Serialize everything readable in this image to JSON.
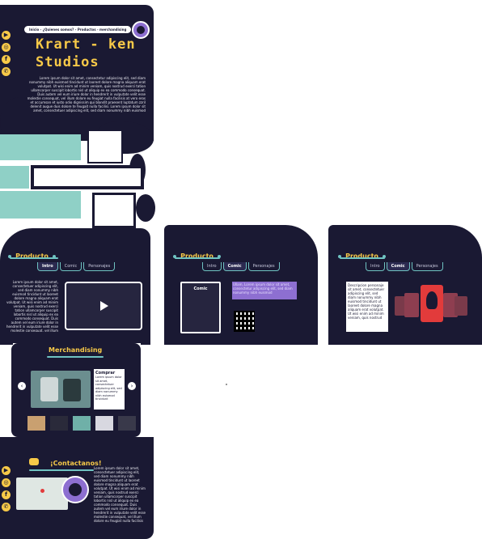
{
  "colors": {
    "navy": "#1a1933",
    "yellow": "#f7c948",
    "teal": "#6fc3c2",
    "purple": "#8d6fd1",
    "red": "#e23b3b"
  },
  "social_icons": [
    "youtube-icon",
    "instagram-icon",
    "facebook-icon",
    "whatsapp-icon"
  ],
  "hero": {
    "breadcrumb": "Inicio - ¿Quienes somos? - Productos - merchandising",
    "title_line1": "Krart - ken",
    "title_line2": "Studios",
    "paragraph": "Lorem ipsum dolor sit amet, consectetur adipiscing elit, sed diam nonummy nibh euismod tincidunt ut laoreet dolore magna aliquam erat volutpat. Ut wisi enim ad minim veniam, quis nostrud exerci tation ullamcorper suscipit lobortis nisl ut aliquip ex ea commodo consequat. Duis autem vel eum iriure dolor in hendrerit in vulputate velit esse molestie consequat, vel illum dolore eu feugiat nulla facilisis at vero eros et accumsan et iusto odio dignissim qui blandit praesent luptatum zzril delenit augue duis dolore te feugait nulla facilisi. Lorem ipsum dolor sit amet, consectetuer adipiscing elit, sed diam nonummy nibh euismod"
  },
  "products": [
    {
      "title": "Producto",
      "tabs": [
        "Intro",
        "Comic",
        "Personajes"
      ],
      "active": "Intro",
      "text": "Lorem ipsum dolor sit amet, consectetuer adipiscing elit, sed diam nonummy nibh euismod tincidunt ut laoreet dolore magna aliquam erat volutpat. Ut wisi enim ad minim veniam, quis nostrud exerci tation ullamcorper suscipit lobortis nisl ut aliquip ex ea commodo consequat. Duis autem vel eum iriure dolor in hendrerit in vulputate velit esse molestie consequat, vel illum dolore eu feugiat nulla"
    },
    {
      "title": "Producto",
      "tabs": [
        "Intro",
        "Comic",
        "Personajes"
      ],
      "active": "Comic",
      "cover_label": "Comic",
      "text": "Ullam, Lorem ipsum dolor sit amet, consectetur adipiscing elit, sed diam nonummy nibh euismod"
    },
    {
      "title": "Producto",
      "tabs": [
        "Intro",
        "Comic",
        "Personajes"
      ],
      "active": "Comic",
      "text": "Descripcion personaje sit amet, consectetuer adipiscing elit, sed diam nonummy nibh euismod tincidunt ut laoreet dolore magna aliquam erat volutpat. Ut wisi enim ad minim veniam, quis nostrud"
    }
  ],
  "merch": {
    "title": "Merchandising",
    "buy_label": "Comprar",
    "text": "Lorem ipsum dolor sit amet, consectetuer adipiscing elit, sed diam nonummy nibh euismod tincidunt"
  },
  "contact": {
    "title": "¡Contactanos!",
    "text": "Lorem ipsum dolor sit amet, consectetuer adipiscing elit, sed diam nonummy nibh euismod tincidunt ut laoreet dolore magna aliquam erat volutpat. Ut wisi enim ad minim veniam, quis nostrud exerci tation ullamcorper suscipit lobortis nisl ut aliquip ex ea commodo consequat. Duis autem vel eum iriure dolor in hendrerit in vulputate velit esse molestie consequat, vel illum dolore eu feugiat nulla facilisis"
  }
}
